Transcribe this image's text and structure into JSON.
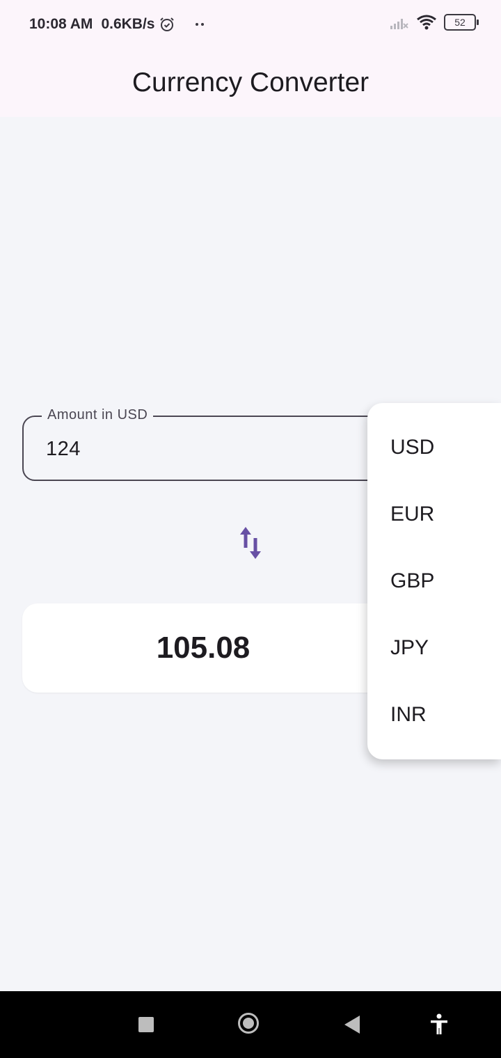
{
  "status_bar": {
    "time": "10:08 AM",
    "network_speed": "0.6KB/s",
    "alarm_icon": "alarm-clock-icon",
    "more_icon": "two-dots-icon",
    "battery_level": "52"
  },
  "app_bar": {
    "title": "Currency Converter"
  },
  "amount_field": {
    "label": "Amount in USD",
    "value": "124"
  },
  "swap_button": {
    "icon": "swap-vertical-icon",
    "color": "#6750a4"
  },
  "result": {
    "value": "105.08"
  },
  "currency_menu": {
    "items": [
      "USD",
      "EUR",
      "GBP",
      "JPY",
      "INR"
    ]
  },
  "nav_bar": {
    "icons": [
      "recents-square-icon",
      "home-circle-icon",
      "back-triangle-icon",
      "accessibility-icon"
    ]
  }
}
